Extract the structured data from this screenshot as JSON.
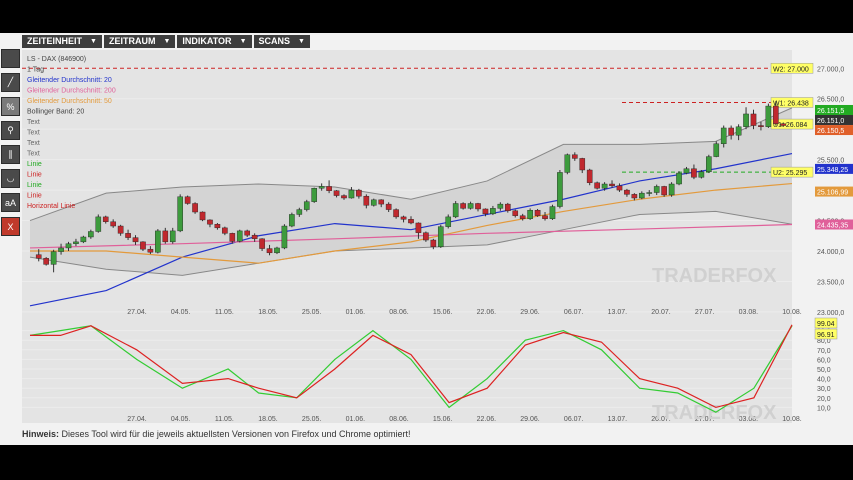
{
  "menu": [
    {
      "label": "ZEITEINHEIT"
    },
    {
      "label": "ZEITRAUM"
    },
    {
      "label": "INDIKATOR"
    },
    {
      "label": "SCANS"
    }
  ],
  "tools": [
    {
      "name": "pointer-tool",
      "glyph": ""
    },
    {
      "name": "line-tool",
      "glyph": "╱"
    },
    {
      "name": "percent-tool",
      "glyph": "%"
    },
    {
      "name": "zoom-tool",
      "glyph": "⚲"
    },
    {
      "name": "parallel-tool",
      "glyph": "∥"
    },
    {
      "name": "curve-tool",
      "glyph": "◡"
    },
    {
      "name": "text-tool",
      "glyph": "aA"
    },
    {
      "name": "delete-tool",
      "glyph": "X"
    }
  ],
  "legend": [
    {
      "text": "LS - DAX (846900)",
      "color": "#444444"
    },
    {
      "text": "1 Tag",
      "color": "#444444"
    },
    {
      "text": "Gleitender Durchschnitt: 20",
      "color": "#2233cc"
    },
    {
      "text": "Gleitender Durchschnitt: 200",
      "color": "#e0609a"
    },
    {
      "text": "Gleitender Durchschnitt: 50",
      "color": "#e39a3c"
    },
    {
      "text": "Bollinger Band: 20",
      "color": "#444444"
    },
    {
      "text": "Text",
      "color": "#666666"
    },
    {
      "text": "Text",
      "color": "#666666"
    },
    {
      "text": "Text",
      "color": "#666666"
    },
    {
      "text": "Text",
      "color": "#666666"
    },
    {
      "text": "Linie",
      "color": "#22aa22"
    },
    {
      "text": "Linie",
      "color": "#cc2222"
    },
    {
      "text": "Linie",
      "color": "#22aa22"
    },
    {
      "text": "Linie",
      "color": "#cc2222"
    },
    {
      "text": "Horizontal Linie",
      "color": "#cc2222"
    }
  ],
  "watermark": "TRADERFOX",
  "footer": {
    "bold": "Hinweis:",
    "text": " Dieses Tool wird für die jeweils aktuellsten Versionen von Firefox und Chrome optimiert!"
  },
  "chart_data": [
    {
      "type": "candlestick",
      "title": "LS - DAX (846900)",
      "interval": "1 Tag",
      "ylim": [
        22900,
        27300
      ],
      "yticks": [
        "27.000,0",
        "26.500,0",
        "26.000,0",
        "25.500,0",
        "25.000,0",
        "24.500,0",
        "24.000,0",
        "23.500,0",
        "23.000,0"
      ],
      "xticks": [
        "27.04.",
        "04.05.",
        "11.05.",
        "18.05.",
        "25.05.",
        "01.06.",
        "08.06.",
        "15.06.",
        "22.06.",
        "29.06.",
        "06.07.",
        "13.07.",
        "20.07.",
        "27.07.",
        "03.08.",
        "10.08."
      ],
      "candles": [
        [
          23940,
          24030,
          23830,
          23880
        ],
        [
          23880,
          23900,
          23760,
          23780
        ],
        [
          23780,
          24020,
          23650,
          23990
        ],
        [
          23990,
          24120,
          23940,
          24050
        ],
        [
          24050,
          24150,
          24000,
          24120
        ],
        [
          24120,
          24200,
          24080,
          24150
        ],
        [
          24150,
          24250,
          24130,
          24230
        ],
        [
          24230,
          24350,
          24200,
          24320
        ],
        [
          24320,
          24600,
          24300,
          24560
        ],
        [
          24560,
          24580,
          24450,
          24480
        ],
        [
          24480,
          24520,
          24380,
          24410
        ],
        [
          24410,
          24430,
          24250,
          24290
        ],
        [
          24290,
          24350,
          24180,
          24220
        ],
        [
          24220,
          24260,
          24100,
          24150
        ],
        [
          24150,
          24160,
          24000,
          24030
        ],
        [
          24030,
          24080,
          23950,
          23980
        ],
        [
          23980,
          24360,
          23960,
          24330
        ],
        [
          24330,
          24380,
          24120,
          24150
        ],
        [
          24150,
          24380,
          24120,
          24330
        ],
        [
          24330,
          24930,
          24310,
          24890
        ],
        [
          24890,
          24910,
          24760,
          24780
        ],
        [
          24780,
          24800,
          24610,
          24640
        ],
        [
          24640,
          24650,
          24490,
          24510
        ],
        [
          24510,
          24520,
          24390,
          24440
        ],
        [
          24440,
          24460,
          24350,
          24380
        ],
        [
          24380,
          24400,
          24260,
          24290
        ],
        [
          24290,
          24300,
          24120,
          24160
        ],
        [
          24160,
          24350,
          24140,
          24330
        ],
        [
          24330,
          24350,
          24230,
          24260
        ],
        [
          24260,
          24290,
          24150,
          24200
        ],
        [
          24200,
          24210,
          24000,
          24040
        ],
        [
          24040,
          24100,
          23930,
          23970
        ],
        [
          23970,
          24070,
          23950,
          24050
        ],
        [
          24050,
          24440,
          24030,
          24410
        ],
        [
          24410,
          24630,
          24390,
          24600
        ],
        [
          24600,
          24710,
          24560,
          24680
        ],
        [
          24680,
          24840,
          24650,
          24810
        ],
        [
          24810,
          25040,
          24790,
          25030
        ],
        [
          25030,
          25110,
          24990,
          25060
        ],
        [
          25060,
          25160,
          24950,
          24990
        ],
        [
          24990,
          25000,
          24880,
          24910
        ],
        [
          24910,
          24930,
          24840,
          24870
        ],
        [
          24870,
          25050,
          24860,
          25000
        ],
        [
          25000,
          25020,
          24860,
          24900
        ],
        [
          24900,
          24930,
          24700,
          24750
        ],
        [
          24750,
          24860,
          24730,
          24840
        ],
        [
          24840,
          24850,
          24720,
          24770
        ],
        [
          24770,
          24800,
          24640,
          24680
        ],
        [
          24680,
          24700,
          24530,
          24560
        ],
        [
          24560,
          24580,
          24470,
          24520
        ],
        [
          24520,
          24570,
          24440,
          24460
        ],
        [
          24460,
          24470,
          24200,
          24300
        ],
        [
          24300,
          24320,
          24150,
          24180
        ],
        [
          24180,
          24200,
          24030,
          24070
        ],
        [
          24070,
          24430,
          24050,
          24400
        ],
        [
          24400,
          24600,
          24370,
          24560
        ],
        [
          24560,
          24820,
          24540,
          24780
        ],
        [
          24780,
          24800,
          24680,
          24700
        ],
        [
          24700,
          24810,
          24680,
          24780
        ],
        [
          24780,
          24790,
          24650,
          24690
        ],
        [
          24690,
          24700,
          24570,
          24610
        ],
        [
          24610,
          24740,
          24590,
          24700
        ],
        [
          24700,
          24800,
          24660,
          24770
        ],
        [
          24770,
          24790,
          24630,
          24660
        ],
        [
          24660,
          24680,
          24550,
          24580
        ],
        [
          24580,
          24610,
          24500,
          24530
        ],
        [
          24530,
          24700,
          24510,
          24670
        ],
        [
          24670,
          24690,
          24560,
          24580
        ],
        [
          24580,
          24640,
          24500,
          24530
        ],
        [
          24530,
          24760,
          24510,
          24730
        ],
        [
          24730,
          25330,
          24700,
          25290
        ],
        [
          25290,
          25600,
          25260,
          25580
        ],
        [
          25580,
          25620,
          25480,
          25520
        ],
        [
          25520,
          25530,
          25280,
          25330
        ],
        [
          25330,
          25350,
          25080,
          25120
        ],
        [
          25120,
          25140,
          25010,
          25030
        ],
        [
          25030,
          25130,
          24990,
          25100
        ],
        [
          25100,
          25160,
          25040,
          25070
        ],
        [
          25070,
          25110,
          24970,
          25000
        ],
        [
          25000,
          25020,
          24890,
          24930
        ],
        [
          24930,
          24950,
          24830,
          24870
        ],
        [
          24870,
          24980,
          24850,
          24950
        ],
        [
          24950,
          25000,
          24900,
          24960
        ],
        [
          24960,
          25090,
          24920,
          25060
        ],
        [
          25060,
          25070,
          24890,
          24920
        ],
        [
          24920,
          25130,
          24890,
          25100
        ],
        [
          25100,
          25310,
          25080,
          25280
        ],
        [
          25280,
          25380,
          25260,
          25350
        ],
        [
          25350,
          25420,
          25180,
          25210
        ],
        [
          25210,
          25330,
          25190,
          25300
        ],
        [
          25300,
          25580,
          25280,
          25550
        ],
        [
          25550,
          25800,
          25540,
          25760
        ],
        [
          25760,
          26060,
          25700,
          26020
        ],
        [
          26020,
          26060,
          25830,
          25900
        ],
        [
          25900,
          26080,
          25820,
          26040
        ],
        [
          26040,
          26360,
          26000,
          26250
        ],
        [
          26250,
          26320,
          26000,
          26060
        ],
        [
          26060,
          26120,
          25980,
          26040
        ],
        [
          26040,
          26420,
          26020,
          26380
        ],
        [
          26380,
          26460,
          26060,
          26090
        ],
        [
          26090,
          26110,
          26040,
          26060
        ]
      ],
      "series": [
        {
          "name": "Gleitender Durchschnitt: 20",
          "color": "#2233cc",
          "x": [
            0,
            10,
            20,
            30,
            40,
            50,
            60,
            70,
            80,
            90,
            100
          ],
          "y": [
            23100,
            23350,
            23900,
            24250,
            24450,
            24350,
            24600,
            24850,
            25150,
            25350,
            25600
          ]
        },
        {
          "name": "Gleitender Durchschnitt: 50",
          "color": "#e39a3c",
          "x": [
            0,
            10,
            20,
            30,
            40,
            50,
            60,
            70,
            80,
            90,
            100
          ],
          "y": [
            24000,
            24000,
            23900,
            23800,
            24000,
            24150,
            24420,
            24650,
            24850,
            25000,
            25107
          ]
        },
        {
          "name": "Gleitender Durchschnitt: 200",
          "color": "#e0609a",
          "x": [
            0,
            20,
            40,
            60,
            80,
            100
          ],
          "y": [
            24050,
            24120,
            24200,
            24290,
            24360,
            24435
          ]
        },
        {
          "name": "Bollinger Band: 20",
          "color": "#888888",
          "x": [
            0,
            10,
            20,
            30,
            40,
            50,
            60,
            70,
            80,
            90,
            100
          ],
          "upper": [
            24500,
            24950,
            25050,
            25100,
            25050,
            24850,
            25150,
            25750,
            25750,
            25800,
            26350
          ],
          "lower": [
            23900,
            23700,
            23600,
            23800,
            24000,
            24050,
            24100,
            24350,
            24600,
            24650,
            24440
          ]
        }
      ],
      "annotations": [
        {
          "label": "W2: 27.000",
          "value": 27000,
          "style": "dashed",
          "color": "#cc2222"
        },
        {
          "label": "W1: 26.438",
          "value": 26438,
          "style": "dashed",
          "color": "#cc2222"
        },
        {
          "label": "U1: 26.084",
          "value": 26084,
          "style": "label",
          "color": "#aaaa00"
        },
        {
          "label": "U2: 25.295",
          "value": 25295,
          "style": "dashed",
          "color": "#22aa22"
        }
      ],
      "price_tags": [
        {
          "label": "26.151,5",
          "value": 26151,
          "color": "#22aa22"
        },
        {
          "label": "26.151,0",
          "value": 26151,
          "color": "#333333"
        },
        {
          "label": "26.150,5",
          "value": 26150,
          "color": "#e0602a"
        },
        {
          "label": "25.348,25",
          "value": 25348,
          "color": "#2233cc"
        },
        {
          "label": "25.106,99",
          "value": 25107,
          "color": "#e39a3c"
        },
        {
          "label": "24.435,35",
          "value": 24435,
          "color": "#e0609a"
        }
      ]
    },
    {
      "type": "line",
      "title": "",
      "ylim": [
        0,
        100
      ],
      "yticks": [
        "90,0",
        "80,0",
        "70,0",
        "60,0",
        "50,0",
        "40,0",
        "30,0",
        "20,0",
        "10,0"
      ],
      "series": [
        {
          "name": "",
          "color": "#33cc33",
          "x": [
            0,
            4,
            8,
            14,
            20,
            26,
            30,
            35,
            40,
            45,
            50,
            55,
            60,
            65,
            70,
            75,
            80,
            85,
            90,
            95,
            100
          ],
          "y": [
            85,
            90,
            95,
            60,
            30,
            50,
            25,
            20,
            60,
            90,
            60,
            10,
            40,
            80,
            90,
            70,
            30,
            25,
            5,
            30,
            95
          ]
        },
        {
          "name": "",
          "color": "#dd2222",
          "x": [
            0,
            4,
            8,
            14,
            20,
            26,
            30,
            35,
            40,
            45,
            50,
            55,
            60,
            65,
            70,
            75,
            80,
            85,
            90,
            95,
            100
          ],
          "y": [
            85,
            85,
            95,
            70,
            35,
            40,
            30,
            20,
            50,
            85,
            65,
            15,
            30,
            75,
            88,
            78,
            40,
            30,
            10,
            20,
            96
          ]
        }
      ],
      "value_tags": [
        {
          "label": "99.04",
          "color": "#33cc33"
        },
        {
          "label": "96.91",
          "color": "#dd2222"
        }
      ]
    }
  ]
}
